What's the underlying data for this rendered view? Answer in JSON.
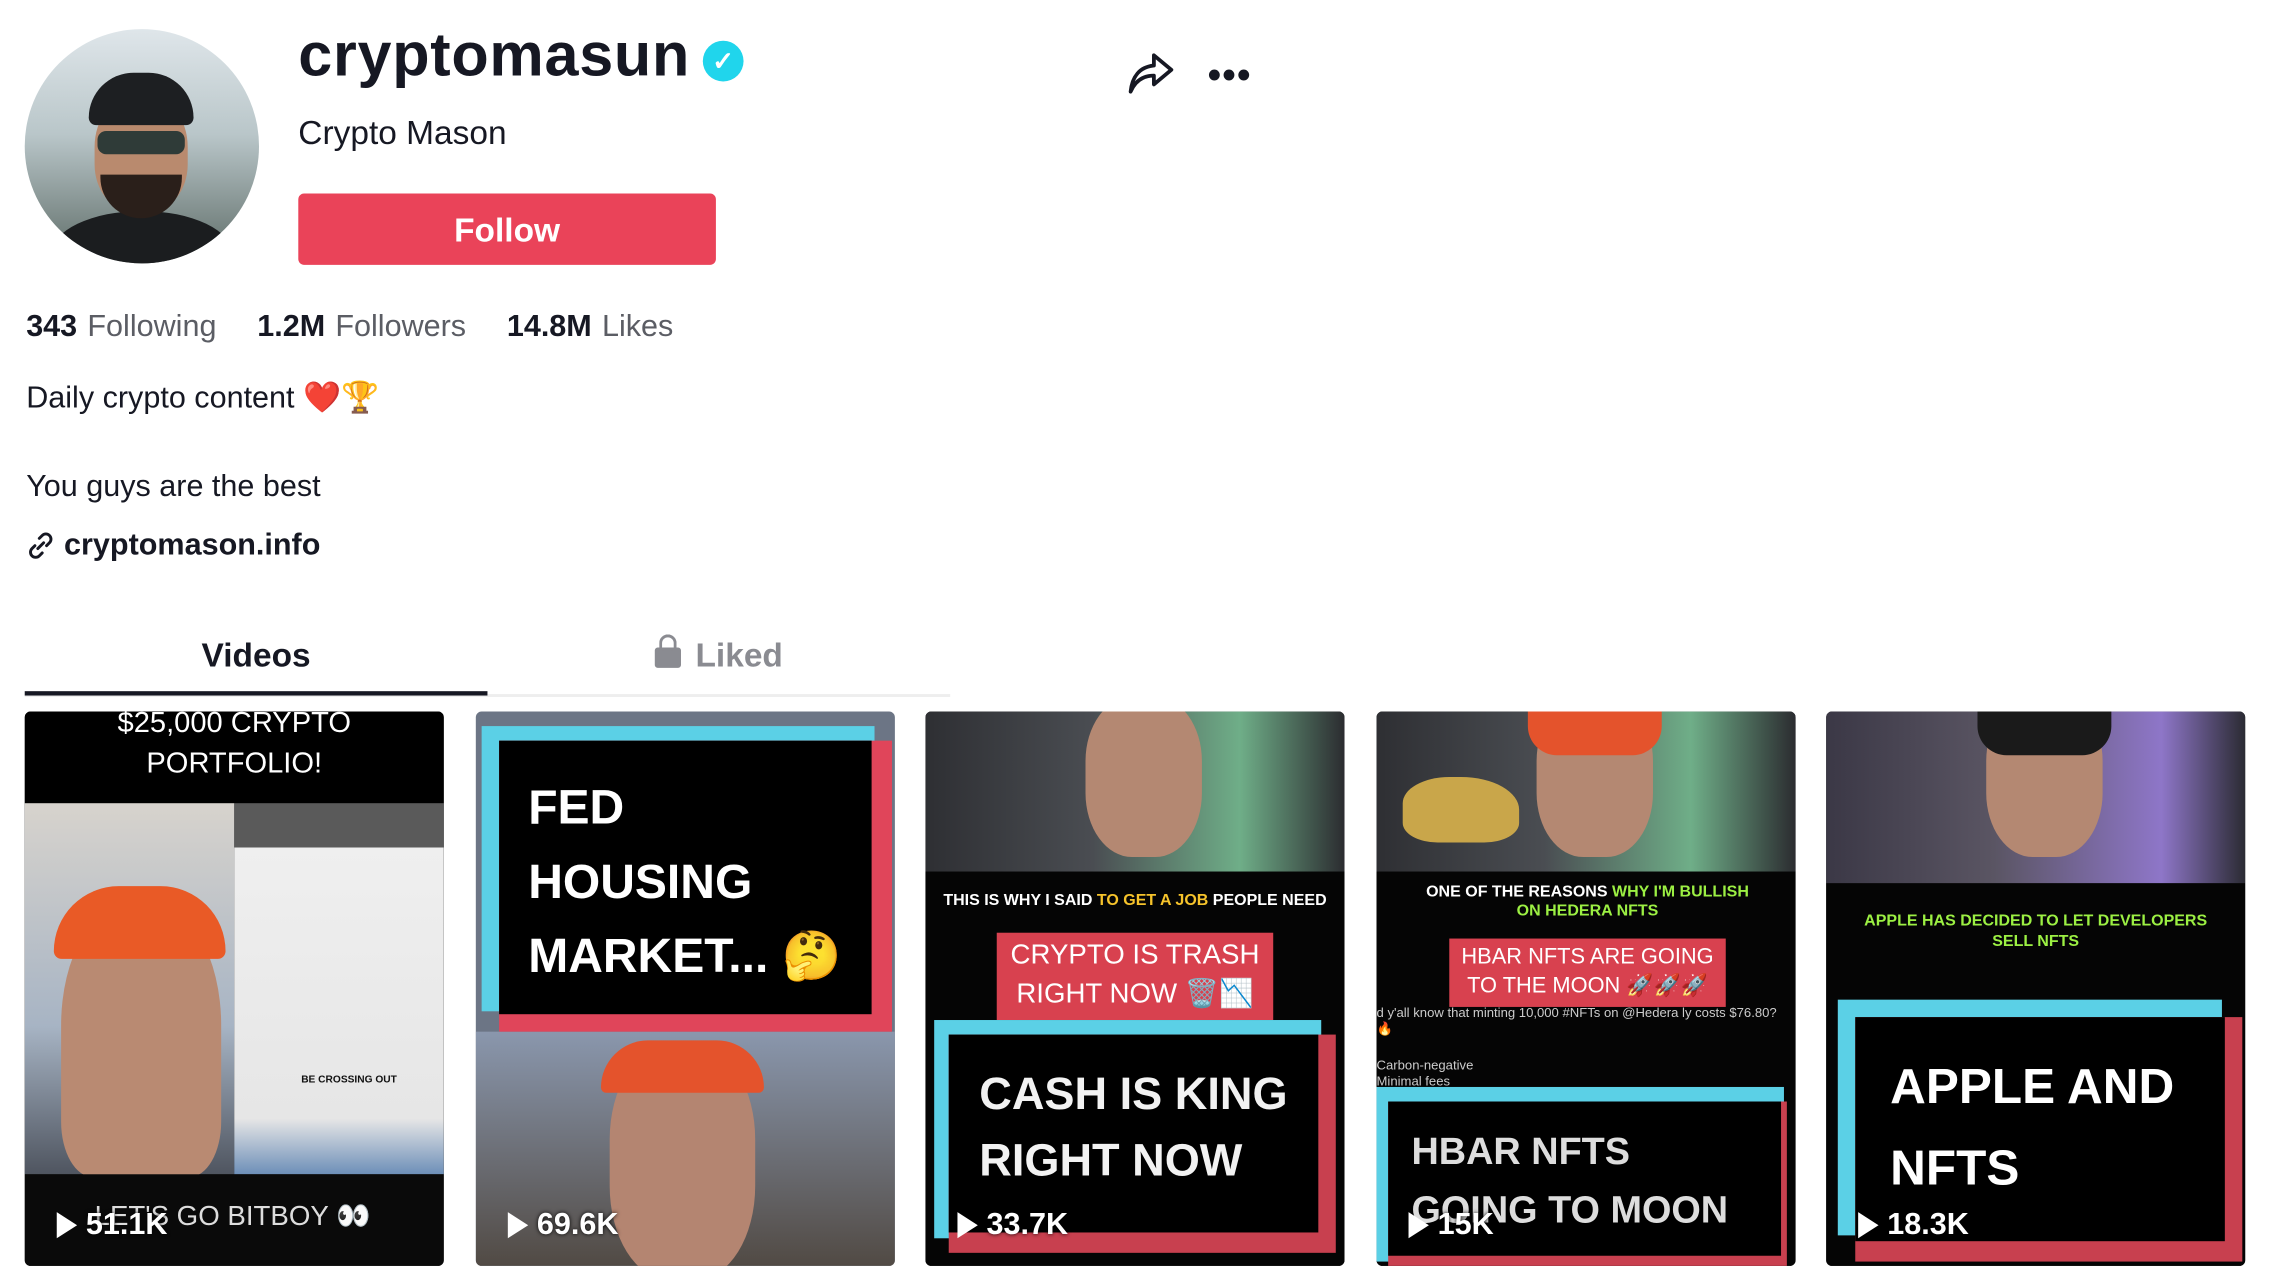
{
  "profile": {
    "username": "cryptomasun",
    "nickname": "Crypto Mason",
    "follow_label": "Follow",
    "verified": true,
    "stats": [
      {
        "value": "343",
        "label": "Following"
      },
      {
        "value": "1.2M",
        "label": "Followers"
      },
      {
        "value": "14.8M",
        "label": "Likes"
      }
    ],
    "bio_line1": "Daily crypto content ❤️🏆",
    "bio_line2": "You guys are the best",
    "link": "cryptomason.info"
  },
  "tabs": [
    {
      "label": "Videos",
      "active": true
    },
    {
      "label": "Liked",
      "locked": true
    }
  ],
  "videos": [
    {
      "views": "51.1K",
      "top_caption": "$25,000 CRYPTO PORTFOLIO!",
      "bottom_caption": "LET'S GO BITBOY 👀",
      "inner_text": "BE CROSSING OUT"
    },
    {
      "views": "69.6K",
      "title_lines": [
        "FED",
        "HOUSING",
        "MARKET... 🤔"
      ]
    },
    {
      "views": "33.7K",
      "subtitle_pre": "THIS IS WHY I SAID ",
      "subtitle_hl": "TO GET A JOB",
      "subtitle_post": " PEOPLE NEED",
      "red_box": [
        "CRYPTO IS TRASH",
        "RIGHT NOW 🗑️📉"
      ],
      "title_lines": [
        "CASH IS KING",
        "RIGHT NOW"
      ]
    },
    {
      "views": "15K",
      "subtitle_pre": "ONE OF THE REASONS ",
      "subtitle_hl": "WHY I'M BULLISH ON HEDERA NFTS",
      "red_box": [
        "HBAR NFTS ARE GOING",
        "TO THE MOON 🚀🚀🚀"
      ],
      "tweet_text": "d y'all know that minting 10,000 #NFTs on @Hedera ly costs $76.80? 🔥",
      "tweet_lines": [
        "Carbon-negative",
        "Minimal fees"
      ],
      "title_lines": [
        "HBAR NFTS",
        "GOING TO MOON"
      ]
    },
    {
      "views": "18.3K",
      "subtitle_hl": "APPLE HAS DECIDED TO LET DEVELOPERS SELL NFTS",
      "title_lines": [
        "APPLE AND",
        "NFTS"
      ]
    }
  ],
  "colors": {
    "follow": "#ea4359",
    "verified": "#20d5ec",
    "cyan": "#5bd0e6",
    "red": "#e0455a",
    "highlight_yellow": "#f6c32b",
    "highlight_green": "#9cf043"
  }
}
